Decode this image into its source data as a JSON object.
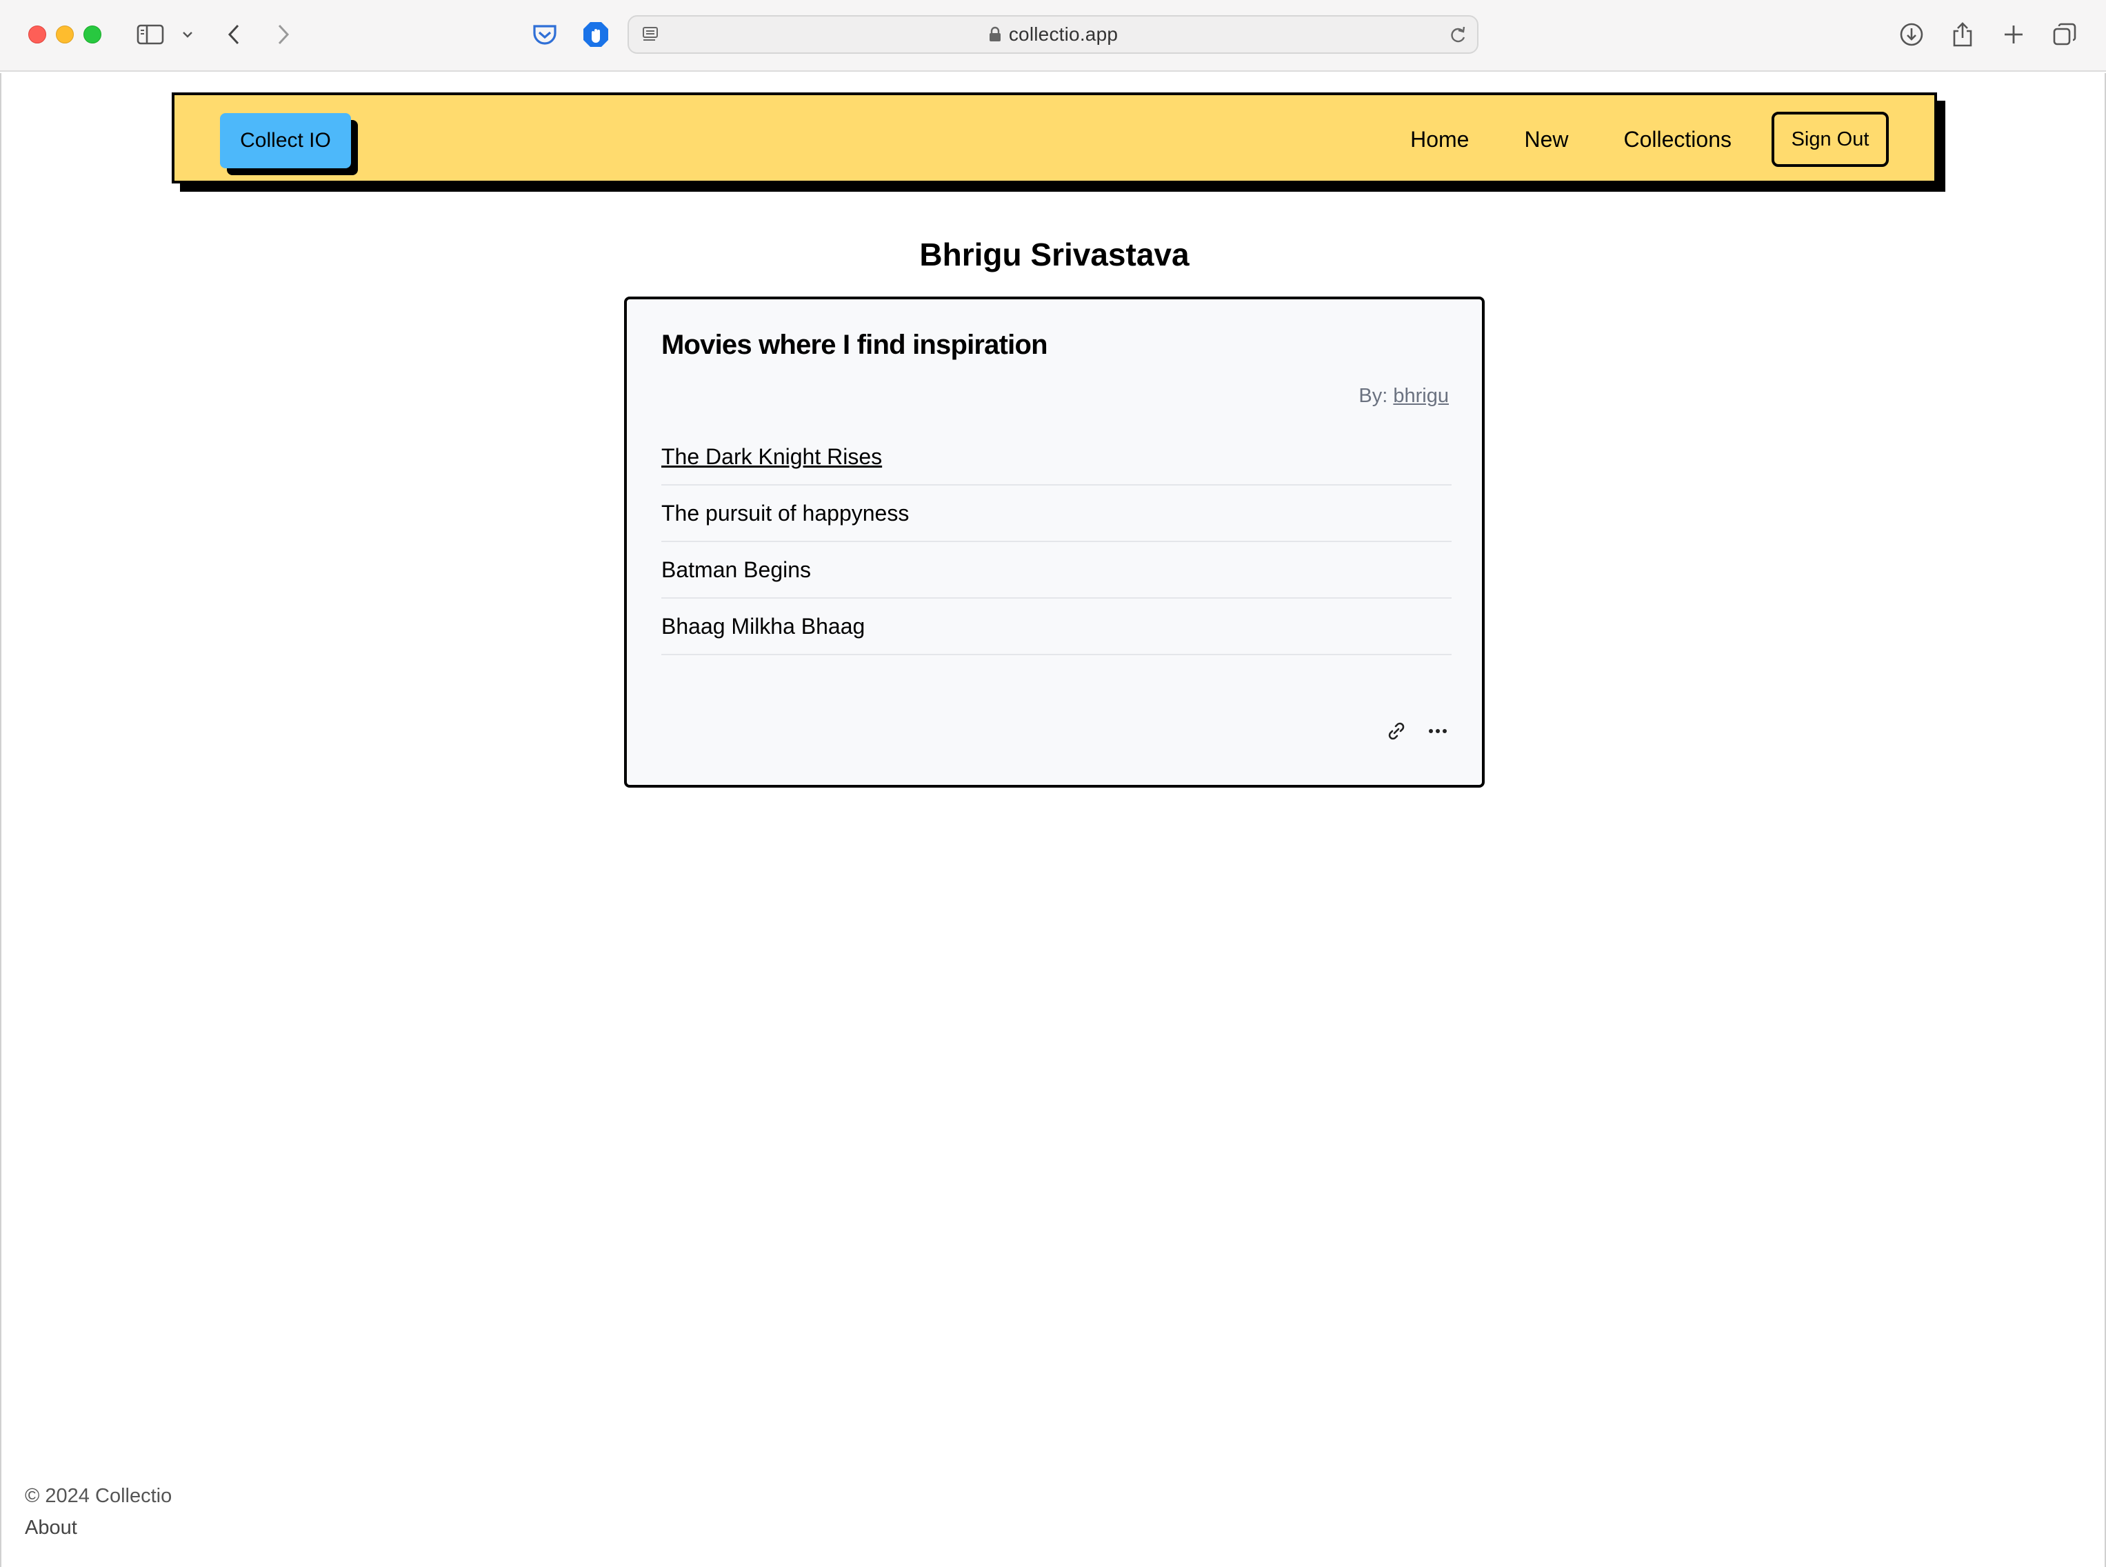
{
  "browser": {
    "url": "collectio.app"
  },
  "navbar": {
    "brand": "Collect IO",
    "links": [
      "Home",
      "New",
      "Collections"
    ],
    "sign_out": "Sign Out",
    "bg_color": "#ffdb6e",
    "brand_color": "#4db8fa"
  },
  "profile": {
    "name": "Bhrigu Srivastava"
  },
  "collection": {
    "title": "Movies where I find inspiration",
    "by_label": "By:",
    "author": "bhrigu",
    "items": [
      "The Dark Knight Rises",
      "The pursuit of happyness",
      "Batman Begins",
      "Bhaag Milkha Bhaag"
    ],
    "actions": [
      "link-icon",
      "more-icon"
    ]
  },
  "footer": {
    "copyright": "© 2024 Collectio",
    "about": "About"
  }
}
